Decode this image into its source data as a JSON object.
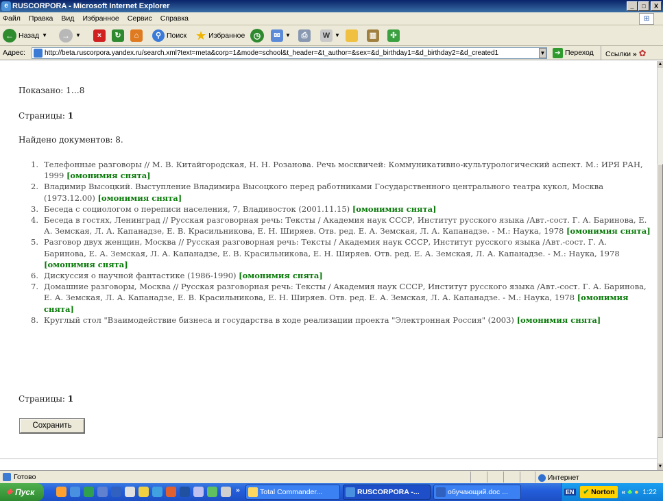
{
  "window": {
    "title": "RUSCORPORA - Microsoft Internet Explorer",
    "minimize": "_",
    "maximize": "□",
    "close": "X"
  },
  "menu": {
    "items": [
      "Файл",
      "Правка",
      "Вид",
      "Избранное",
      "Сервис",
      "Справка"
    ]
  },
  "toolbar": {
    "back_label": "Назад",
    "search_label": "Поиск",
    "favorites_label": "Избранное"
  },
  "address": {
    "label": "Адрес:",
    "url": "http://beta.ruscorpora.yandex.ru/search.xml?text=meta&corp=1&mode=school&t_header=&t_author=&sex=&d_birthday1=&d_birthday2=&d_created1",
    "go_label": "Переход",
    "links_label": "Ссылки"
  },
  "content": {
    "shown": "Показано: 1…8",
    "pages_label": "Страницы:",
    "pages_value": "1",
    "found": "Найдено документов: 8.",
    "homonymy_label": "[омонимия снята]",
    "save_label": "Сохранить",
    "documents": [
      {
        "num": "1.",
        "text": "Телефонные разговоры // М. В. Китайгородская, Н. Н. Розанова. Речь москвичей: Коммуникативно-культурологический аспект. М.: ИРЯ РАН, 1999"
      },
      {
        "num": "2.",
        "text": "Владимир Высоцкий. Выступление Владимира Высоцкого перед работниками Государственного центрального театра кукол, Москва (1973.12.00)"
      },
      {
        "num": "3.",
        "text": "Беседа с социологом о переписи населения, 7, Владивосток (2001.11.15)"
      },
      {
        "num": "4.",
        "text": "Беседа в гостях, Ленинград // Русская разговорная речь: Тексты / Академия наук СССР, Институт русского языка /Авт.-сост. Г. А. Баринова, Е. А. Земская, Л. А. Капанадзе, Е. В. Красильникова, Е. Н. Ширяев. Отв. ред. Е. А. Земская, Л. А. Капанадзе. - М.: Наука, 1978"
      },
      {
        "num": "5.",
        "text": "Разговор двух женщин, Москва // Русская разговорная речь: Тексты / Академия наук СССР, Институт русского языка /Авт.-сост. Г. А. Баринова, Е. А. Земская, Л. А. Капанадзе, Е. В. Красильникова, Е. Н. Ширяев. Отв. ред. Е. А. Земская, Л. А. Капанадзе. - М.: Наука, 1978"
      },
      {
        "num": "6.",
        "text": "Дискуссия о научной фантастике (1986-1990)"
      },
      {
        "num": "7.",
        "text": "Домашние разговоры, Москва // Русская разговорная речь: Тексты / Академия наук СССР, Институт русского языка /Авт.-сост. Г. А. Баринова, Е. А. Земская, Л. А. Капанадзе, Е. В. Красильникова, Е. Н. Ширяев. Отв. ред. Е. А. Земская, Л. А. Капанадзе. - М.: Наука, 1978"
      },
      {
        "num": "8.",
        "text": "Круглый стол \"Взаимодействие бизнеса и государства в ходе реализации проекта \"Электронная Россия\" (2003)"
      }
    ]
  },
  "status": {
    "text": "Готово",
    "zone": "Интернет"
  },
  "taskbar": {
    "start_label": "Пуск",
    "overflow": "»",
    "tasks": [
      "Total Commander...",
      "RUSCORPORA -...",
      "обучающий.doc ..."
    ],
    "tray_lang": "EN",
    "norton_label": "Norton",
    "tray_more": "«",
    "clock": "1:22"
  }
}
